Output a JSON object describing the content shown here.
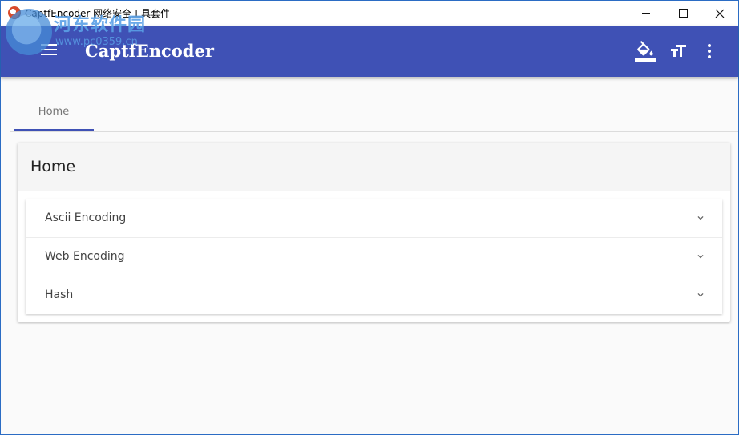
{
  "window": {
    "title": "CaptfEncoder 网络安全工具套件",
    "controls": {
      "minimize": "minimize",
      "maximize": "maximize",
      "close": "close"
    }
  },
  "watermark": {
    "text": "河东软件园",
    "sub": "www.pc0359.cn"
  },
  "appbar": {
    "title": "CaptfEncoder",
    "background": "#3f51b5",
    "icons": [
      "menu-icon",
      "paint-bucket-icon",
      "text-size-icon",
      "more-vert-icon"
    ]
  },
  "tabs": [
    {
      "label": "Home",
      "active": true
    }
  ],
  "card": {
    "title": "Home",
    "panels": [
      {
        "label": "Ascii Encoding"
      },
      {
        "label": "Web Encoding"
      },
      {
        "label": "Hash"
      }
    ]
  }
}
